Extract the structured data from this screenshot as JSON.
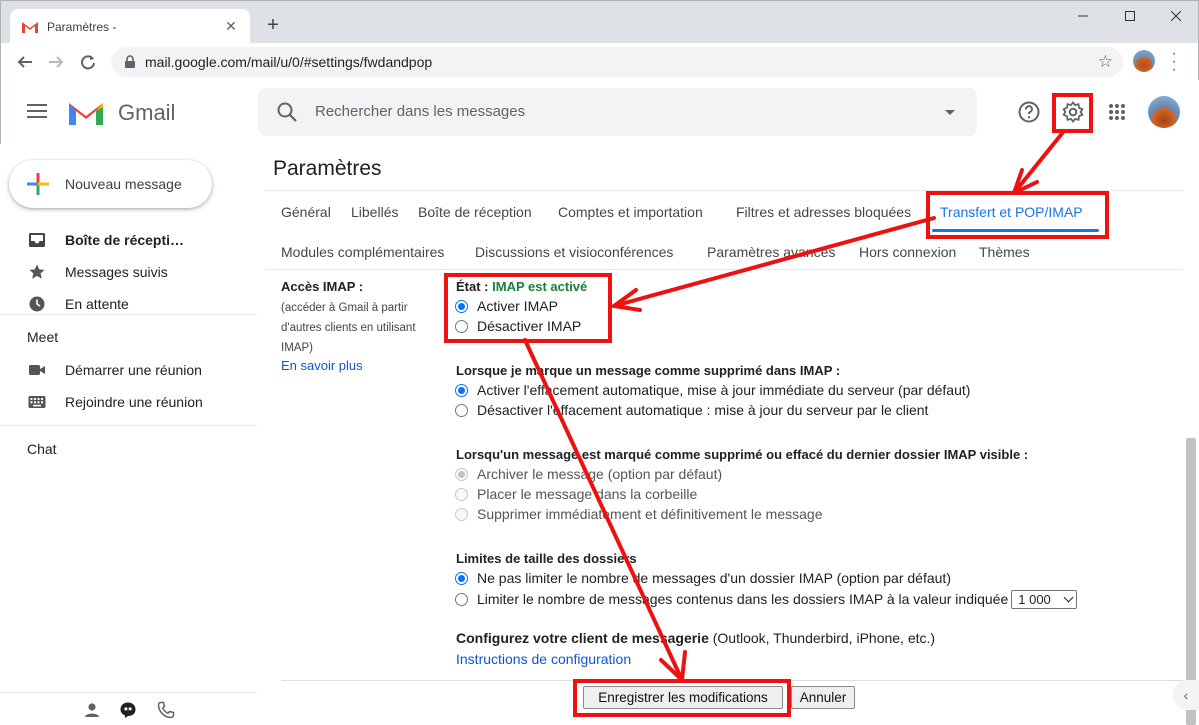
{
  "browser": {
    "tab_title": "Paramètres -",
    "url": "mail.google.com/mail/u/0/#settings/fwdandpop",
    "new_tab": "+",
    "close_tab": "✕"
  },
  "gmail": {
    "product_name": "Gmail",
    "search_placeholder": "Rechercher dans les messages",
    "compose_label": "Nouveau message",
    "nav": [
      "Boîte de récepti…",
      "Messages suivis",
      "En attente"
    ],
    "meet_title": "Meet",
    "meet_items": [
      "Démarrer une réunion",
      "Rejoindre une réunion"
    ],
    "chat_title": "Chat"
  },
  "settings": {
    "title": "Paramètres",
    "tabs_row1": [
      "Général",
      "Libellés",
      "Boîte de réception",
      "Comptes et importation",
      "Filtres et adresses bloquées",
      "Transfert et POP/IMAP"
    ],
    "tabs_row2": [
      "Modules complémentaires",
      "Discussions et visioconférences",
      "Paramètres avancés",
      "Hors connexion",
      "Thèmes"
    ],
    "active_tab": "Transfert et POP/IMAP",
    "imap_label": "Accès IMAP :",
    "imap_description": "(accéder à Gmail à partir d'autres clients en utilisant IMAP)",
    "learn_more": "En savoir plus",
    "state_label": "État : ",
    "state_value": "IMAP est activé",
    "imap_options": [
      "Activer IMAP",
      "Désactiver IMAP"
    ],
    "expunge_heading": "Lorsque je marque un message comme supprimé dans IMAP :",
    "expunge_options": [
      "Activer l'effacement automatique, mise à jour immédiate du serveur (par défaut)",
      "Désactiver l'effacement automatique : mise à jour du serveur par le client"
    ],
    "deleted_heading": "Lorsqu'un message est marqué comme supprimé ou effacé du dernier dossier IMAP visible :",
    "deleted_options": [
      "Archiver le message (option par défaut)",
      "Placer le message dans la corbeille",
      "Supprimer immédiatement et définitivement le message"
    ],
    "limits_heading": "Limites de taille des dossiers",
    "limits_options": [
      "Ne pas limiter le nombre de messages d'un dossier IMAP (option par défaut)",
      "Limiter le nombre de messages contenus dans les dossiers IMAP à la valeur indiquée"
    ],
    "limit_value": "1 000",
    "client_heading": "Configurez votre client de messagerie",
    "client_examples": " (Outlook, Thunderbird, iPhone, etc.)",
    "config_link": "Instructions de configuration",
    "save_button": "Enregistrer les modifications",
    "cancel_button": "Annuler"
  },
  "colors": {
    "annotation_red": "#ee1111",
    "link_blue": "#1155cc",
    "active_tab_blue": "#1a73e8",
    "state_green": "#188038"
  },
  "icons": [
    "gmail-logo-icon",
    "search-icon",
    "help-icon",
    "gear-icon",
    "apps-grid-icon",
    "inbox-icon",
    "star-icon",
    "clock-icon",
    "video-icon",
    "keyboard-icon",
    "person-icon",
    "chat-bubble-icon",
    "phone-icon"
  ]
}
